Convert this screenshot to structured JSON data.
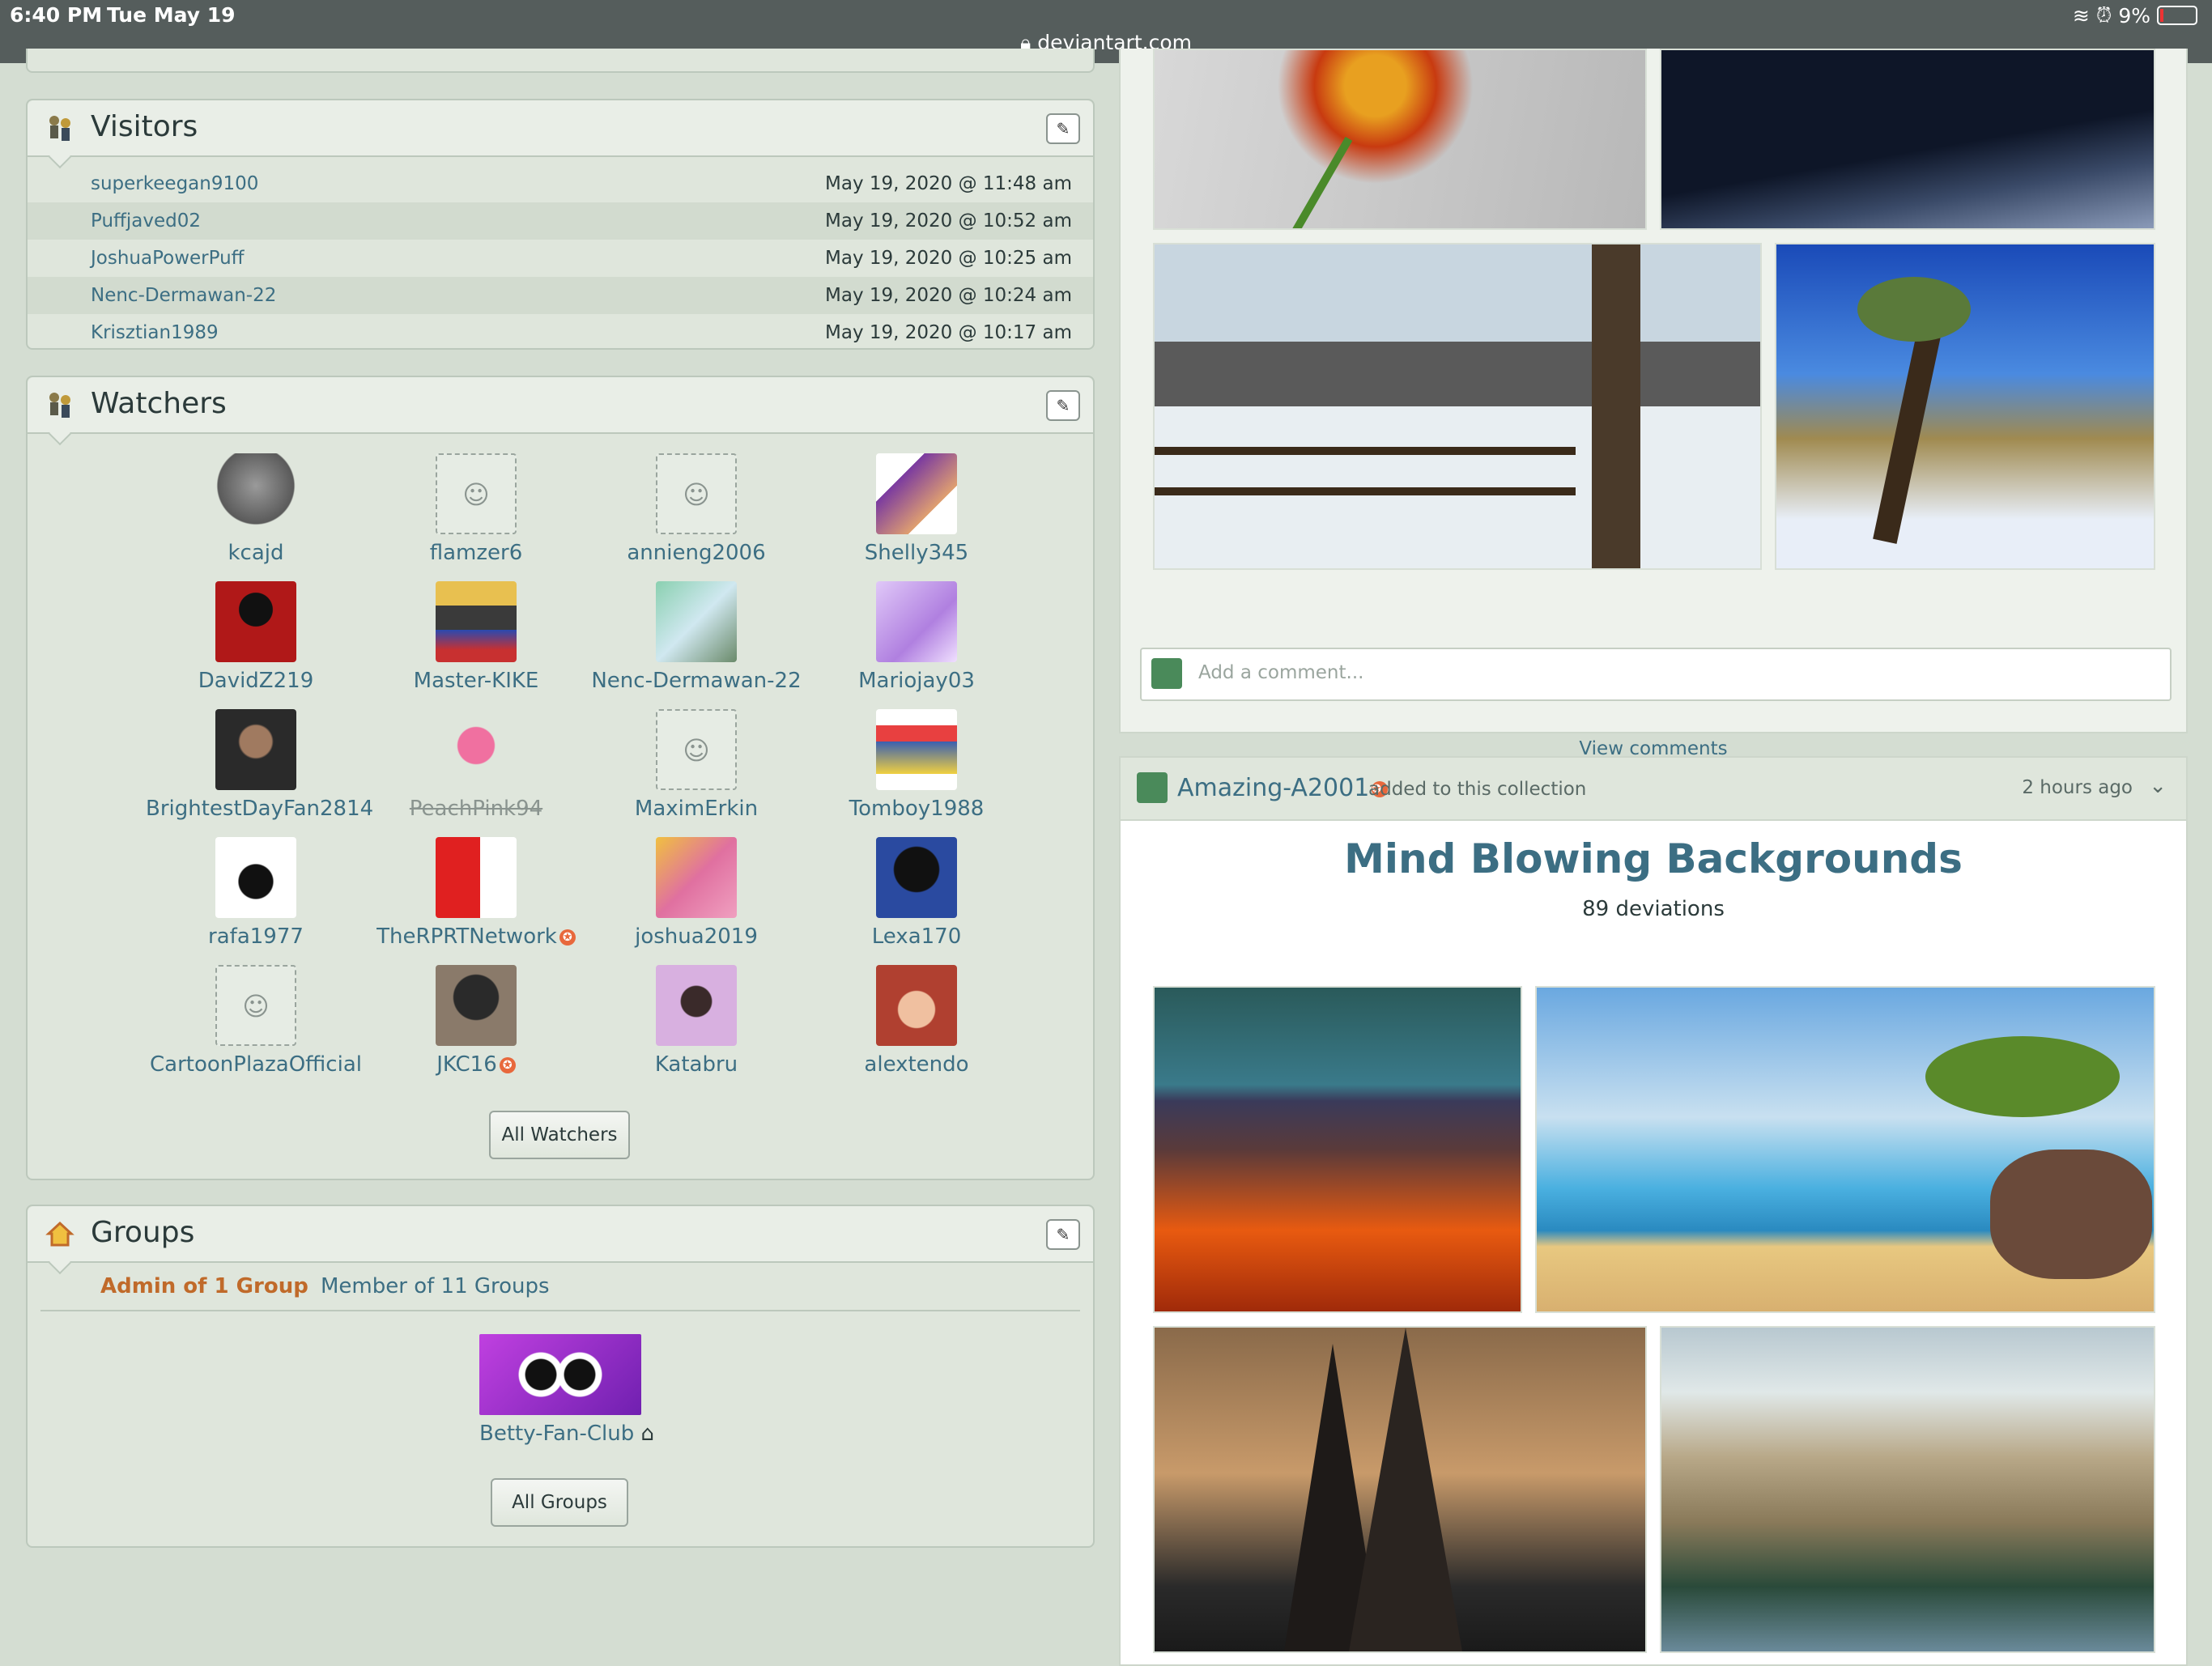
{
  "status": {
    "time": "6:40 PM",
    "date": "Tue May 19",
    "url": "deviantart.com",
    "battery": "9%"
  },
  "visitors": {
    "title": "Visitors",
    "rows": [
      {
        "name": "superkeegan9100",
        "time": "May 19, 2020 @ 11:48 am"
      },
      {
        "name": "Puffjaved02",
        "time": "May 19, 2020 @ 10:52 am"
      },
      {
        "name": "JoshuaPowerPuff",
        "time": "May 19, 2020 @ 10:25 am"
      },
      {
        "name": "Nenc-Dermawan-22",
        "time": "May 19, 2020 @ 10:24 am"
      },
      {
        "name": "Krisztian1989",
        "time": "May 19, 2020 @ 10:17 am"
      }
    ]
  },
  "watchers": {
    "title": "Watchers",
    "items": [
      {
        "name": "kcajd"
      },
      {
        "name": "flamzer6"
      },
      {
        "name": "annieng2006"
      },
      {
        "name": "Shelly345"
      },
      {
        "name": "DavidZ219"
      },
      {
        "name": "Master-KIKE"
      },
      {
        "name": "Nenc-Dermawan-22"
      },
      {
        "name": "Mariojay03"
      },
      {
        "name": "BrightestDayFan2814"
      },
      {
        "name": "PeachPink94"
      },
      {
        "name": "MaximErkin"
      },
      {
        "name": "Tomboy1988"
      },
      {
        "name": "rafa1977"
      },
      {
        "name": "TheRPRTNetwork"
      },
      {
        "name": "joshua2019"
      },
      {
        "name": "Lexa170"
      },
      {
        "name": "CartoonPlazaOfficial"
      },
      {
        "name": "JKC16"
      },
      {
        "name": "Katabru"
      },
      {
        "name": "alextendo"
      }
    ],
    "all_button": "All Watchers"
  },
  "groups": {
    "title": "Groups",
    "tab_admin": "Admin of 1 Group",
    "tab_member": "Member of 11 Groups",
    "group_name": "Betty-Fan-Club",
    "all_button": "All Groups"
  },
  "gallery": {
    "comment_placeholder": "Add a comment...",
    "view_comments": "View comments"
  },
  "collection": {
    "user": "Amazing-A2001",
    "added_text": "added to this collection",
    "time_ago": "2 hours ago",
    "title": "Mind Blowing Backgrounds",
    "count": "89 deviations"
  },
  "colors": {
    "accent_link": "#3c6e83",
    "admin_tab": "#c06a2a",
    "badge": "#e8683c"
  }
}
